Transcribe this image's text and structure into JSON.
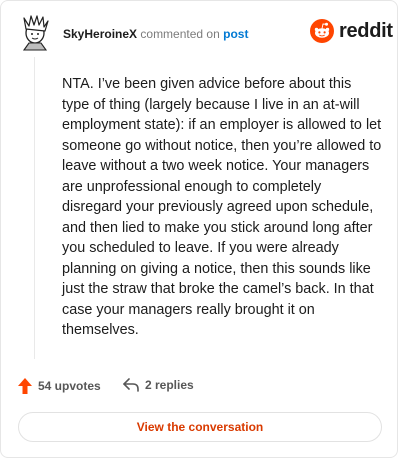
{
  "header": {
    "username": "SkyHeroineX",
    "action_text": "commented on",
    "post_link": "post"
  },
  "brand": {
    "wordmark": "reddit",
    "logo_icon": "reddit-snoo-icon",
    "accent_color": "#ff4500"
  },
  "comment": {
    "body": "NTA. I’ve been given advice before about this type of thing (largely because I live in an at-will employment state): if an employer is allowed to let someone go without notice, then you’re allowed to leave without a two week notice. Your managers are unprofessional enough to completely disregard your previously agreed upon schedule, and then lied to make you stick around long after you scheduled to leave. If you were already planning on giving a notice, then this sounds like just the straw that broke the camel’s back. In that case your managers really brought it on themselves."
  },
  "footer": {
    "upvotes_label": "54 upvotes",
    "upvote_icon": "upvote-arrow-icon",
    "upvote_color": "#ff4500",
    "replies_label": "2 replies",
    "reply_icon": "reply-arrow-icon",
    "view_conversation_label": "View the conversation",
    "view_conversation_color": "#d93a00"
  }
}
